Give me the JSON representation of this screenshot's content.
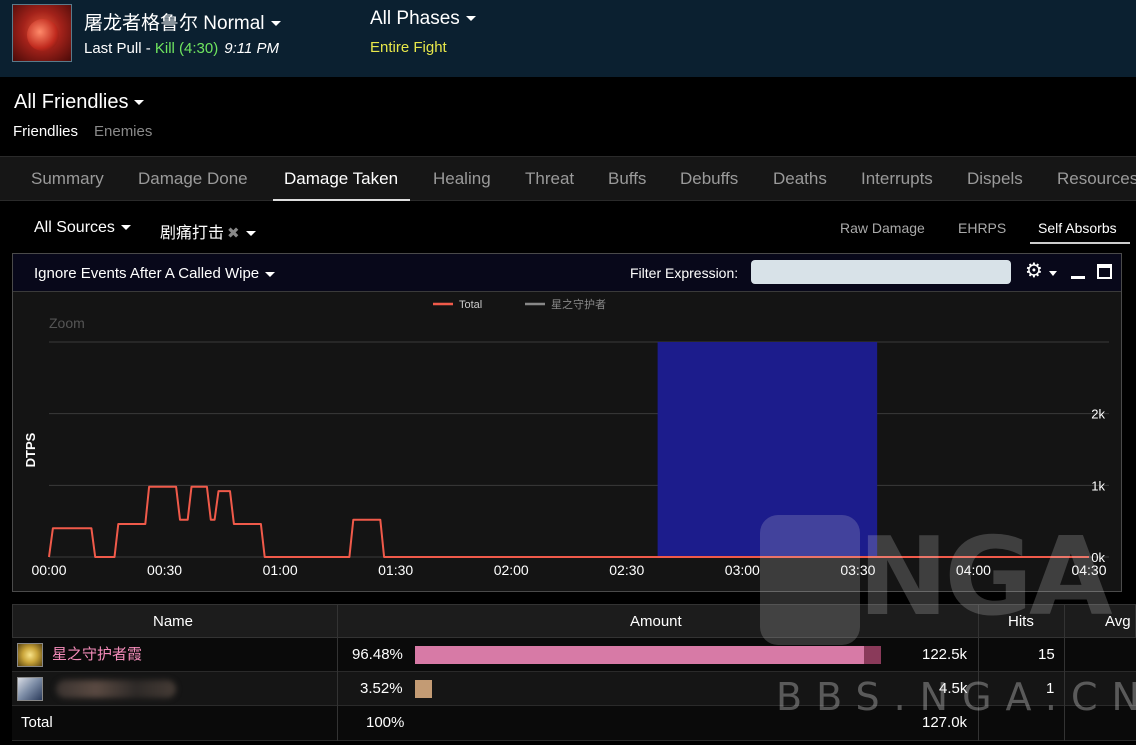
{
  "header": {
    "boss_name": "屠龙者格鲁尔 Normal",
    "pull_label": "Last Pull - ",
    "pull_result": "Kill (4:30)",
    "pull_time": "9:11 PM",
    "phase_title": "All Phases",
    "phase_subtitle": "Entire Fight"
  },
  "friendlies": {
    "title": "All Friendlies",
    "filters": [
      "Friendlies",
      "Enemies"
    ]
  },
  "tabs": [
    "Summary",
    "Damage Done",
    "Damage Taken",
    "Healing",
    "Threat",
    "Buffs",
    "Debuffs",
    "Deaths",
    "Interrupts",
    "Dispels",
    "Resources"
  ],
  "active_tab": "Damage Taken",
  "filter_bar": {
    "sources": "All Sources",
    "ability": "剧痛打击",
    "metrics": [
      "Raw Damage",
      "EHRPS",
      "Self Absorbs"
    ],
    "active_metric": "Self Absorbs"
  },
  "panel": {
    "ignore_label": "Ignore Events After A Called Wipe",
    "filter_label": "Filter Expression:",
    "filter_value": ""
  },
  "colors": {
    "header_bg": "#0b2030",
    "line_total": "#f05a4a",
    "selection": "#1c1c8c",
    "bar_pink": "#d77aa6",
    "bar_tan": "#c39b74",
    "kill": "#6fe55f",
    "phase_sub": "#e8e84a"
  },
  "chart_data": {
    "type": "line",
    "ylabel": "DTPS",
    "zoom_label": "Zoom",
    "legend": [
      {
        "name": "Total",
        "color": "#f05a4a"
      },
      {
        "name": "星之守护者",
        "color": "#888888"
      }
    ],
    "x_ticks": [
      "00:00",
      "00:30",
      "01:00",
      "01:30",
      "02:00",
      "02:30",
      "03:00",
      "03:30",
      "04:00",
      "04:30"
    ],
    "y_ticks": [
      "0k",
      "1k",
      "2k"
    ],
    "xlim": [
      0,
      270
    ],
    "ylim": [
      0,
      3000
    ],
    "selection": [
      158,
      215
    ],
    "series": [
      {
        "name": "Total",
        "x": [
          0,
          1,
          11,
          12,
          17,
          18,
          25,
          26,
          33,
          34,
          36,
          37,
          41,
          42,
          43,
          44,
          47,
          48,
          50,
          51,
          55,
          56,
          60,
          61,
          78,
          79,
          86,
          87,
          95,
          96,
          108,
          109,
          115,
          116,
          126,
          127,
          145,
          146,
          153,
          154,
          156,
          157,
          163,
          164,
          168,
          169,
          175,
          176,
          187,
          188,
          189,
          190,
          195,
          196,
          200,
          201,
          207,
          208,
          214,
          215,
          228,
          229,
          240,
          241,
          244,
          245,
          253,
          254,
          257,
          258,
          262,
          263,
          264,
          265,
          267,
          268,
          270
        ],
        "y": [
          0,
          400,
          400,
          0,
          0,
          460,
          460,
          980,
          980,
          520,
          520,
          980,
          980,
          520,
          520,
          920,
          920,
          460,
          460,
          460,
          460,
          0,
          0,
          0,
          0,
          520,
          520,
          0,
          0,
          0,
          0,
          0,
          0,
          0,
          0,
          0,
          0,
          0,
          0,
          0,
          0,
          0,
          0,
          0,
          0,
          0,
          0,
          0,
          0,
          0,
          0,
          0,
          0,
          0,
          0,
          0,
          0,
          0,
          0,
          0,
          0,
          0,
          0,
          0,
          0,
          0,
          0,
          0,
          0,
          0,
          0,
          0,
          0,
          0,
          0,
          0,
          0
        ]
      }
    ]
  },
  "table": {
    "columns": [
      "Name",
      "Amount",
      "Hits",
      "Avg"
    ],
    "rows": [
      {
        "name": "星之守护者霞",
        "percent": "96.48%",
        "fraction": 0.9648,
        "amount": "122.5k",
        "hits": "15"
      },
      {
        "name": "",
        "percent": "3.52%",
        "fraction": 0.0352,
        "amount": "4.5k",
        "hits": "1"
      }
    ],
    "total": {
      "label": "Total",
      "percent": "100%",
      "amount": "127.0k"
    }
  },
  "watermark": {
    "logo_text": "NGA",
    "url": "BBS.NGA.CN"
  }
}
